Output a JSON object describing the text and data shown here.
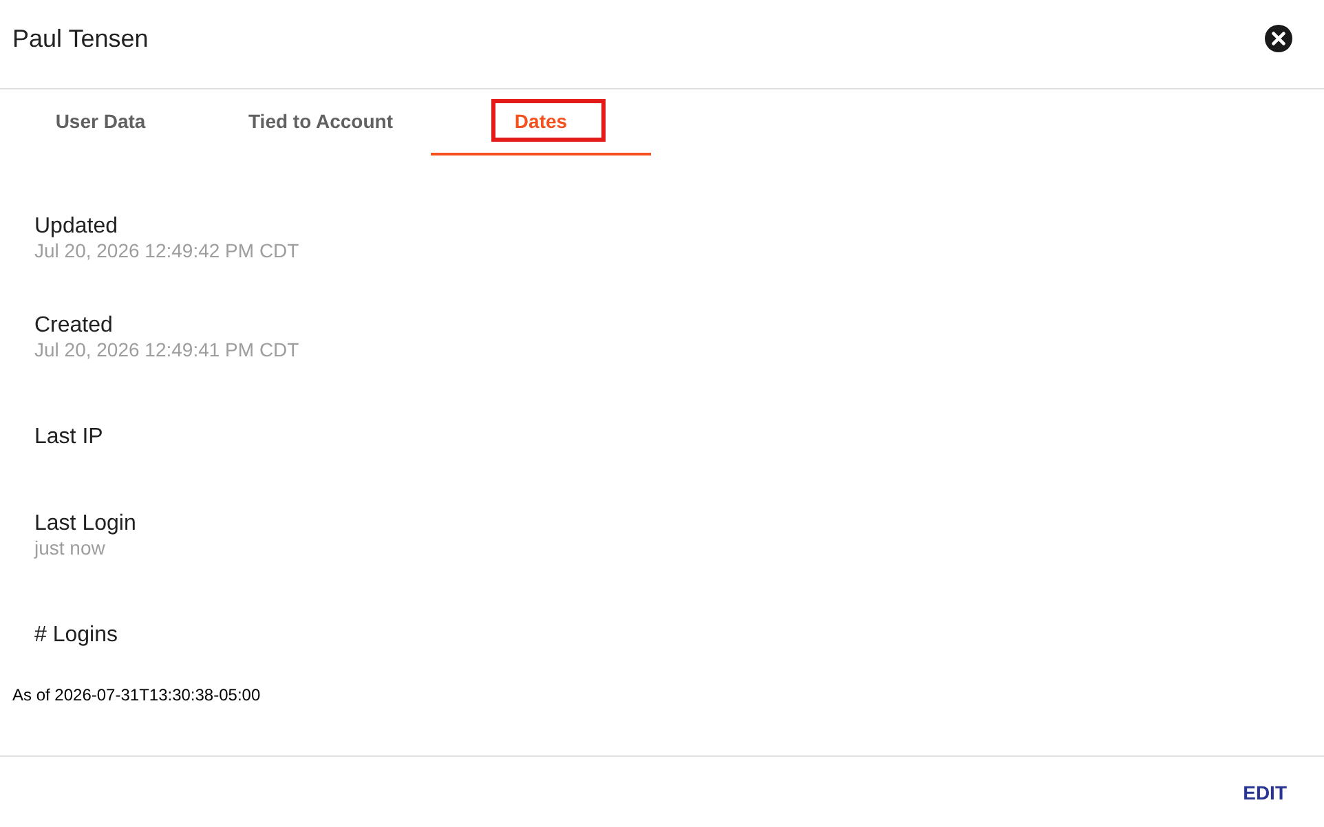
{
  "dialog": {
    "title": "Paul Tensen"
  },
  "tabs": [
    {
      "label": "User Data",
      "selected": false,
      "highlighted": false
    },
    {
      "label": "Tied to Account",
      "selected": false,
      "highlighted": false
    },
    {
      "label": "Dates",
      "selected": true,
      "highlighted": true
    }
  ],
  "fields": [
    {
      "label": "Updated",
      "value": "Jul 20, 2026 12:49:42 PM CDT"
    },
    {
      "label": "Created",
      "value": "Jul 20, 2026 12:49:41 PM CDT"
    },
    {
      "label": "Last IP"
    },
    {
      "label": "Last Login",
      "value": "just now"
    },
    {
      "label": "# Logins"
    }
  ],
  "as_of": "As of 2026-07-31T13:30:38-05:00",
  "footer": {
    "buttons": [
      "EDIT"
    ]
  }
}
